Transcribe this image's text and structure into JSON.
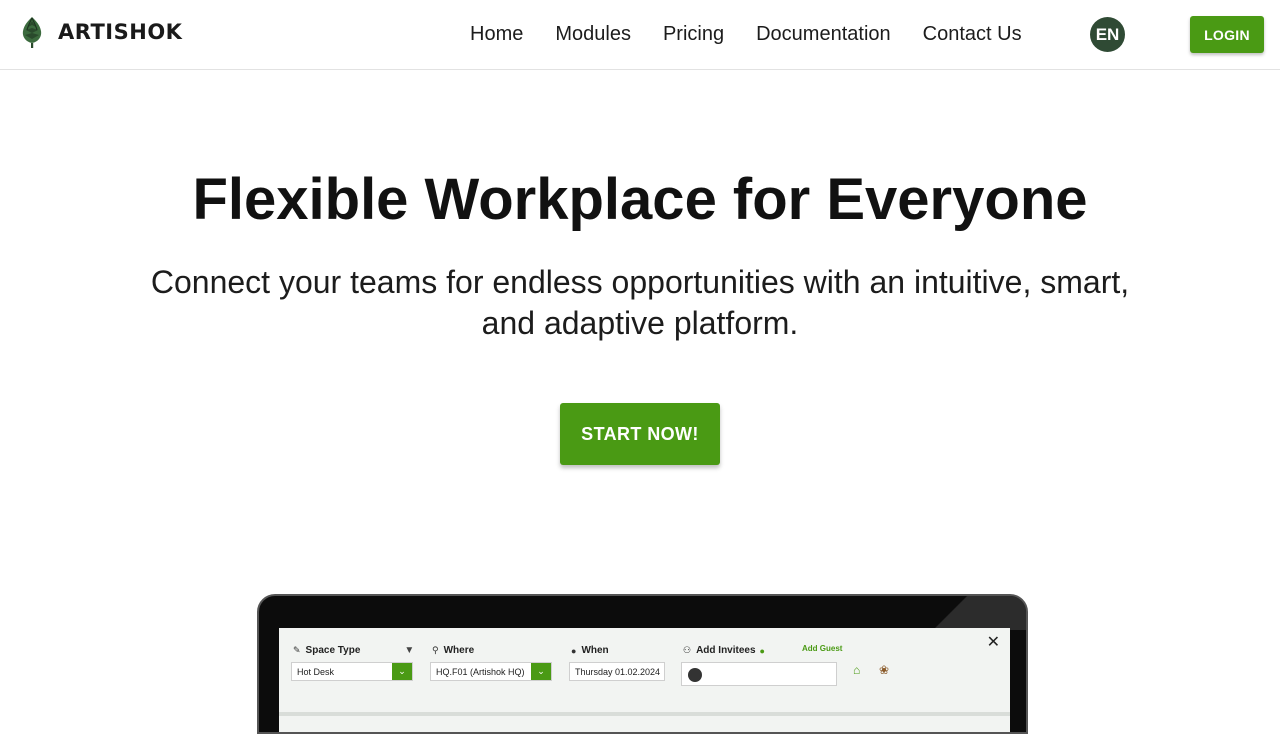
{
  "header": {
    "logo_text": "ARTISHOK",
    "nav": [
      "Home",
      "Modules",
      "Pricing",
      "Documentation",
      "Contact Us"
    ],
    "lang": "EN",
    "login": "LOGIN"
  },
  "hero": {
    "title": "Flexible Workplace for Everyone",
    "subtitle_line1": "Connect your teams for endless opportunities with an intuitive, smart,",
    "subtitle_line2": "and adaptive platform.",
    "cta": "START NOW!"
  },
  "booking": {
    "space_type_label": "Space Type",
    "space_type_value": "Hot Desk",
    "where_label": "Where",
    "where_value": "HQ.F01 (Artishok HQ)",
    "when_label": "When",
    "when_value": "Thursday 01.02.2024",
    "invitees_label": "Add Invitees",
    "add_guest": "Add Guest",
    "close": "✕"
  },
  "colors": {
    "accent": "#4a9a14",
    "lang_badge": "#2f4a34"
  }
}
